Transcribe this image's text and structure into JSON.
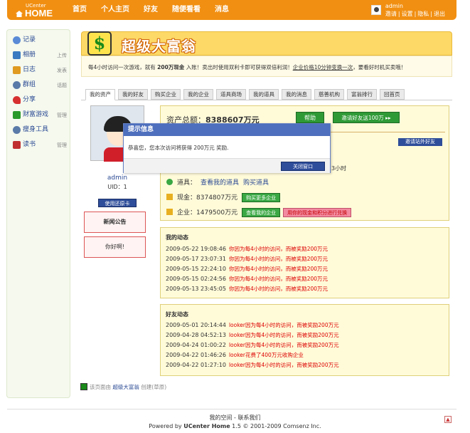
{
  "header": {
    "logo_small": "UCenter",
    "logo_big": "HOME",
    "nav": [
      "首页",
      "个人主页",
      "好友",
      "随便看看",
      "消息"
    ],
    "username": "admin",
    "user_links": [
      "邀请",
      "|",
      "设置",
      "|",
      "隐私",
      "|",
      "退出"
    ]
  },
  "sidebar": {
    "items": [
      {
        "label": "记录",
        "action": "",
        "icon": "record-icon",
        "color": "#5a8ad6"
      },
      {
        "label": "相册",
        "action": "上传",
        "icon": "album-icon",
        "color": "#3a7ac0"
      },
      {
        "label": "日志",
        "action": "发表",
        "icon": "blog-icon",
        "color": "#e09a20"
      },
      {
        "label": "群组",
        "action": "话题",
        "icon": "group-icon",
        "color": "#5a7aa8"
      },
      {
        "label": "分享",
        "action": "",
        "icon": "share-icon",
        "color": "#d63030"
      },
      {
        "label": "财富游戏",
        "action": "管理",
        "icon": "money-game-icon",
        "color": "#2a9a2a"
      },
      {
        "label": "瘦身工具",
        "action": "",
        "icon": "slim-tool-icon",
        "color": "#5a7aa8"
      },
      {
        "label": "读书",
        "action": "管理",
        "icon": "book-icon",
        "color": "#c03030"
      }
    ]
  },
  "banner": {
    "title": "超级大富翁",
    "desc_part1": "每4小时访问一次游戏，就有 ",
    "desc_bold": "200万现金",
    "desc_part2": " 入账！卖出时使用双利卡即可获得双倍利润！",
    "desc_link": "企业价格10分钟变换一次",
    "desc_part3": "，要看好时机买卖哦！"
  },
  "tabs": [
    "我的资产",
    "我的好友",
    "购买企业",
    "我的企业",
    "道具商场",
    "我的道具",
    "我的消息",
    "慈善机构",
    "富翁排行",
    "回首页"
  ],
  "profile": {
    "name": "admin",
    "uid": "UID：1",
    "use_card": "使用还原卡",
    "notice_title": "新闻公告",
    "notice_text": "你好啊!"
  },
  "assets": {
    "total_label": "资产总额：",
    "total_value": "8388607万元",
    "help": "帮助",
    "invite": "邀请好友送100万 ▸▸",
    "invite_abroad": "邀请站外好友",
    "hours_tail": "3小时",
    "props_label": "道具：",
    "props_link1": "查看我的道具",
    "props_link2": "购买道具",
    "cash_label": "现金：",
    "cash_value": "8374807万元",
    "cash_btn": "购买更多企业",
    "corp_label": "企业：",
    "corp_value": "1479500万元",
    "corp_btn": "查看我的企业",
    "corp_btn2": "用你的现金和积分进行兑换"
  },
  "my_activity": {
    "title": "我的动态",
    "rows": [
      {
        "time": "2009-05-22 19:08:46",
        "msg": "你因为每4小时的访问，而被奖励200万元"
      },
      {
        "time": "2009-05-17 23:07:31",
        "msg": "你因为每4小时的访问，而被奖励200万元"
      },
      {
        "time": "2009-05-15 22:24:10",
        "msg": "你因为每4小时的访问，而被奖励200万元"
      },
      {
        "time": "2009-05-15 02:24:56",
        "msg": "你因为每4小时的访问，而被奖励200万元"
      },
      {
        "time": "2009-05-13 23:45:05",
        "msg": "你因为每4小时的访问，而被奖励200万元"
      }
    ]
  },
  "friend_activity": {
    "title": "好友动态",
    "rows": [
      {
        "time": "2009-05-01 20:14:44",
        "msg": "looker因为每4小时的访问，而被奖励200万元"
      },
      {
        "time": "2009-04-28 04:52:13",
        "msg": "looker因为每4小时的访问，而被奖励200万元"
      },
      {
        "time": "2009-04-24 01:00:22",
        "msg": "looker因为每4小时的访问，而被奖励200万元"
      },
      {
        "time": "2009-04-22 01:46:26",
        "msg": "looker花费了400万元收购企业"
      },
      {
        "time": "2009-04-22 01:27:10",
        "msg": "looker因为每4小时的访问，而被奖励200万元"
      }
    ]
  },
  "source": {
    "prefix": "该页面由 ",
    "link": "超级大富翁",
    "suffix": " 创建(草原)"
  },
  "footer": {
    "line1": "我的空间 - 联系我们",
    "line2_prefix": "Powered by ",
    "line2_brand": "UCenter Home",
    "line2_suffix": " 1.5 © 2001-2009 Comsenz Inc."
  },
  "popup": {
    "title": "提示信息",
    "message": "恭喜您，您本次访问将获得  200万元  奖励.",
    "button": "关闭窗口"
  },
  "colors": {
    "header": "#f18f12",
    "accent_blue": "#2e4d9a",
    "green": "#2e9a36",
    "panel_yellow": "#fffbd9"
  }
}
